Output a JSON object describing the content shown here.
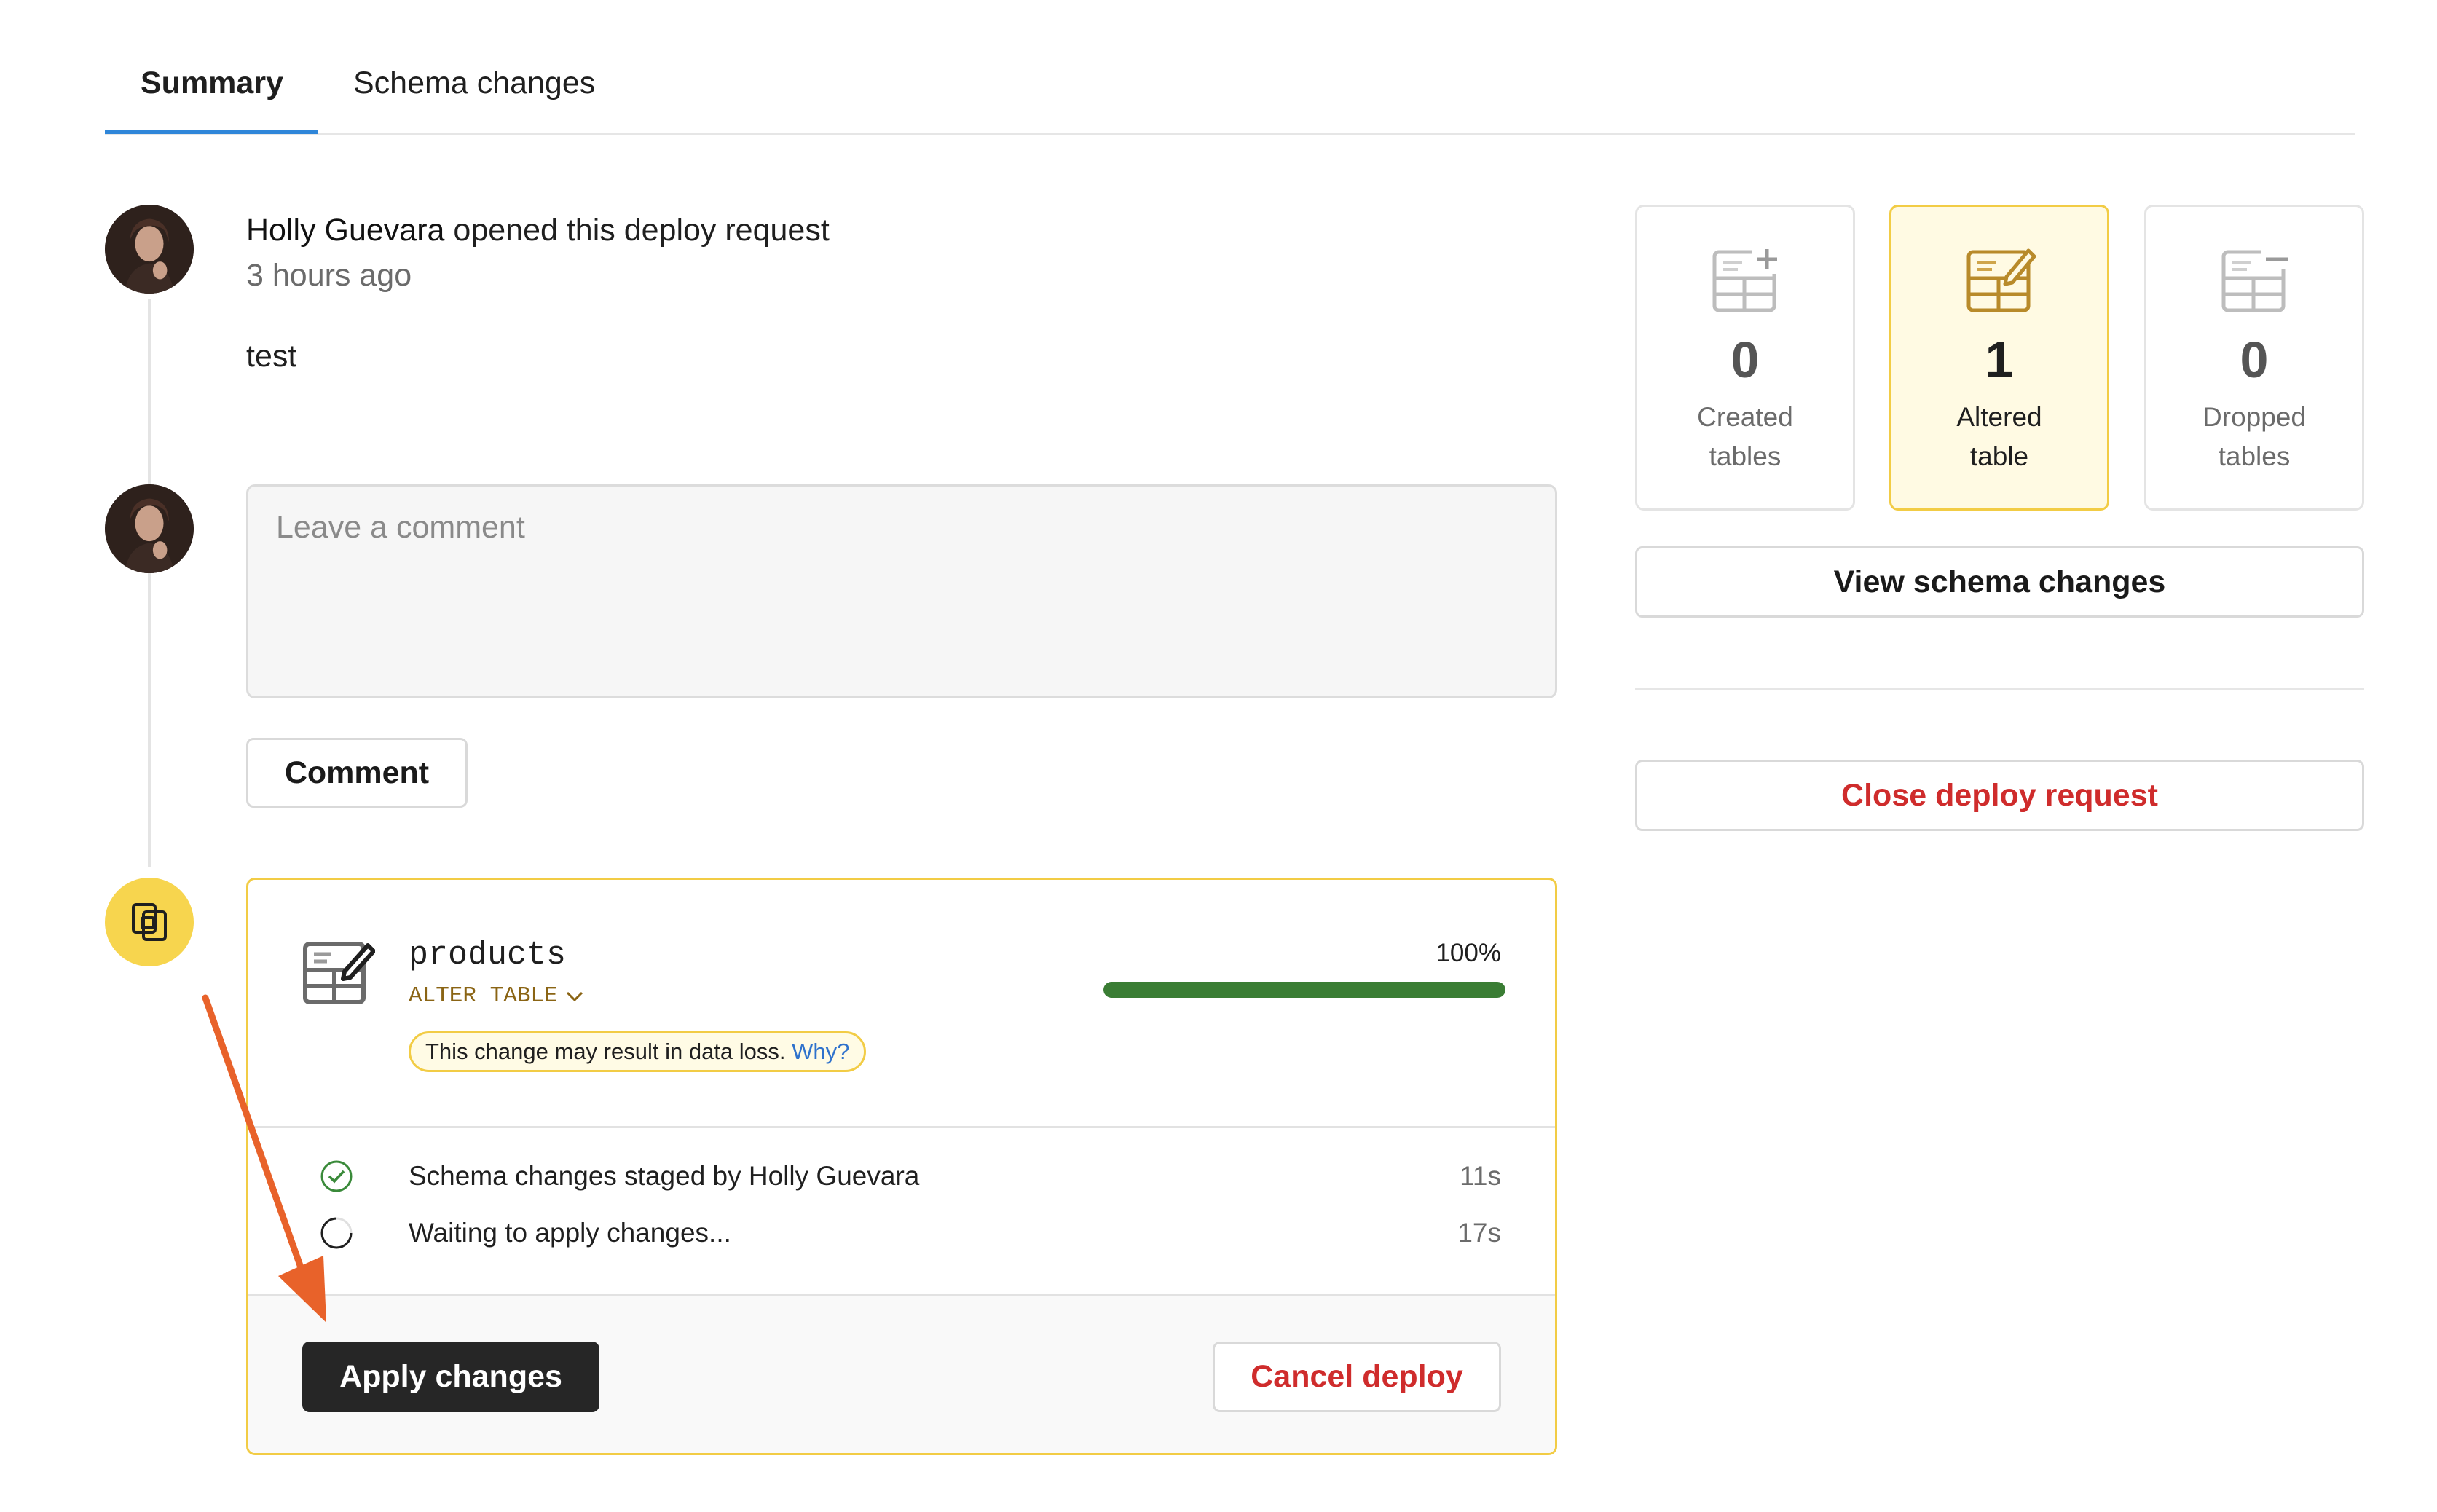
{
  "tabs": [
    {
      "label": "Summary",
      "active": true
    },
    {
      "label": "Schema changes",
      "active": false
    }
  ],
  "timeline": {
    "event": {
      "user": "Holly Guevara",
      "action": "opened this deploy request",
      "time": "3 hours ago",
      "body": "test"
    },
    "comment": {
      "placeholder": "Leave a comment",
      "button_label": "Comment"
    },
    "deploy": {
      "table_name": "products",
      "operation": "ALTER TABLE",
      "warning_text": "This change may result in data loss.",
      "warning_link": "Why?",
      "progress_label": "100%",
      "progress_value": 1.0,
      "steps": [
        {
          "label": "Schema changes staged by Holly Guevara",
          "time": "11s",
          "status": "done"
        },
        {
          "label": "Waiting to apply changes...",
          "time": "17s",
          "status": "pending"
        }
      ],
      "apply_label": "Apply changes",
      "cancel_label": "Cancel deploy"
    }
  },
  "stats": [
    {
      "number": "0",
      "label_line1": "Created",
      "label_line2": "tables",
      "icon": "table-add-icon"
    },
    {
      "number": "1",
      "label_line1": "Altered",
      "label_line2": "table",
      "icon": "table-edit-icon"
    },
    {
      "number": "0",
      "label_line1": "Dropped",
      "label_line2": "tables",
      "icon": "table-remove-icon"
    }
  ],
  "actions": {
    "view_schema_label": "View schema changes",
    "close_label": "Close deploy request"
  },
  "colors": {
    "accent_blue": "#2f86d9",
    "highlight_yellow": "#f2cc45",
    "progress_green": "#3a7d34",
    "danger_red": "#cf2c2c",
    "annotation_orange": "#e8622a"
  }
}
